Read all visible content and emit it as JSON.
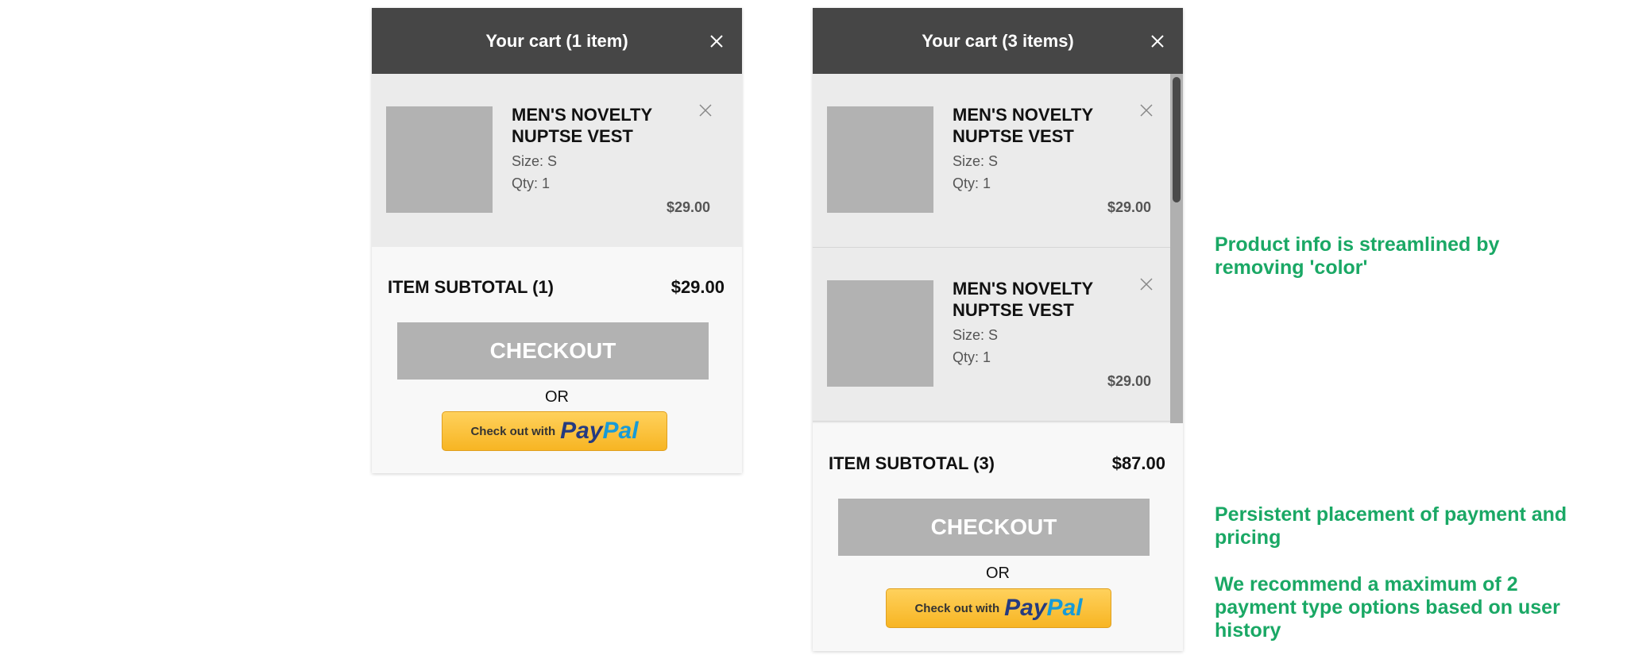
{
  "cart_one": {
    "title": "Your cart (1 item)",
    "items": [
      {
        "name": "MEN'S NOVELTY NUPTSE VEST",
        "size": "Size: S",
        "qty": "Qty: 1",
        "price": "$29.00"
      }
    ],
    "subtotal_label": "ITEM SUBTOTAL (1)",
    "subtotal_value": "$29.00",
    "checkout_label": "CHECKOUT",
    "or_label": "OR",
    "paypal_prefix": "Check out with",
    "paypal_logo_pay": "Pay",
    "paypal_logo_pal": "Pal"
  },
  "cart_three": {
    "title": "Your cart (3 items)",
    "items": [
      {
        "name": "MEN'S NOVELTY NUPTSE VEST",
        "size": "Size: S",
        "qty": "Qty: 1",
        "price": "$29.00"
      },
      {
        "name": "MEN'S NOVELTY NUPTSE VEST",
        "size": "Size: S",
        "qty": "Qty: 1",
        "price": "$29.00"
      }
    ],
    "subtotal_label": "ITEM SUBTOTAL (3)",
    "subtotal_value": "$87.00",
    "checkout_label": "CHECKOUT",
    "or_label": "OR",
    "paypal_prefix": "Check out with",
    "paypal_logo_pay": "Pay",
    "paypal_logo_pal": "Pal"
  },
  "annotations": {
    "product_info": "Product info is streamlined by removing 'color'",
    "persistent_placement": "Persistent placement of payment and pricing",
    "payment_recommendation": "We recommend a maximum of 2 payment type options based on user history"
  },
  "colors": {
    "header_bg": "#464646",
    "items_bg": "#ebebeb",
    "checkout_bg": "#b2b2b2",
    "annotation": "#1aa865",
    "paypal_bg": "#f7b523"
  },
  "icons": {
    "close": "close-icon",
    "remove_item": "remove-item-icon"
  }
}
